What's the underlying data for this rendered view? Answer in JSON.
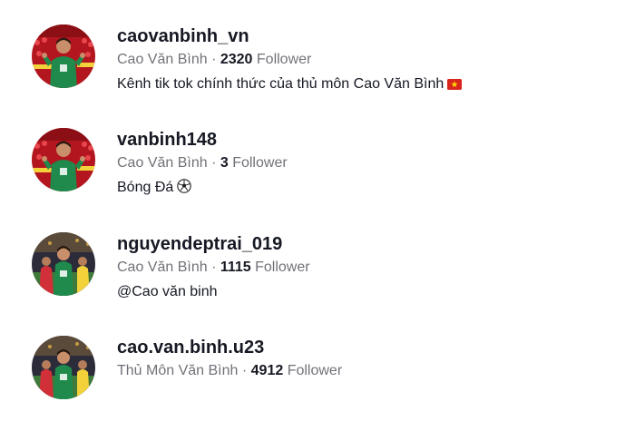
{
  "results": [
    {
      "username": "caovanbinh_vn",
      "display_name": "Cao Văn Bình",
      "separator": " · ",
      "follower_count": "2320",
      "follower_label": "Follower",
      "bio": "Kênh tik tok chính thức của thủ môn Cao Văn Bình",
      "bio_icon": "vietnam-flag-icon",
      "avatar_icon": "goalkeeper-red-crowd-avatar"
    },
    {
      "username": "vanbinh148",
      "display_name": "Cao Văn Bình",
      "separator": " · ",
      "follower_count": "3",
      "follower_label": "Follower",
      "bio": "Bóng Đá",
      "bio_icon": "soccer-ball-icon",
      "avatar_icon": "goalkeeper-red-crowd-avatar"
    },
    {
      "username": "nguyendeptrai_019",
      "display_name": "Cao Văn Bình",
      "separator": " · ",
      "follower_count": "1115",
      "follower_label": "Follower",
      "bio": "@Cao văn binh",
      "avatar_icon": "goalkeeper-stadium-avatar"
    },
    {
      "username": "cao.van.binh.u23",
      "display_name": "Thủ Môn Văn Bình",
      "separator": " · ",
      "follower_count": "4912",
      "follower_label": "Follower",
      "avatar_icon": "goalkeeper-stadium-avatar"
    }
  ],
  "colors": {
    "text_primary": "#161823",
    "text_secondary": "#75767c",
    "goalkeeper_kit": "#1f8a4c",
    "crowd_red": "#c8202a"
  }
}
